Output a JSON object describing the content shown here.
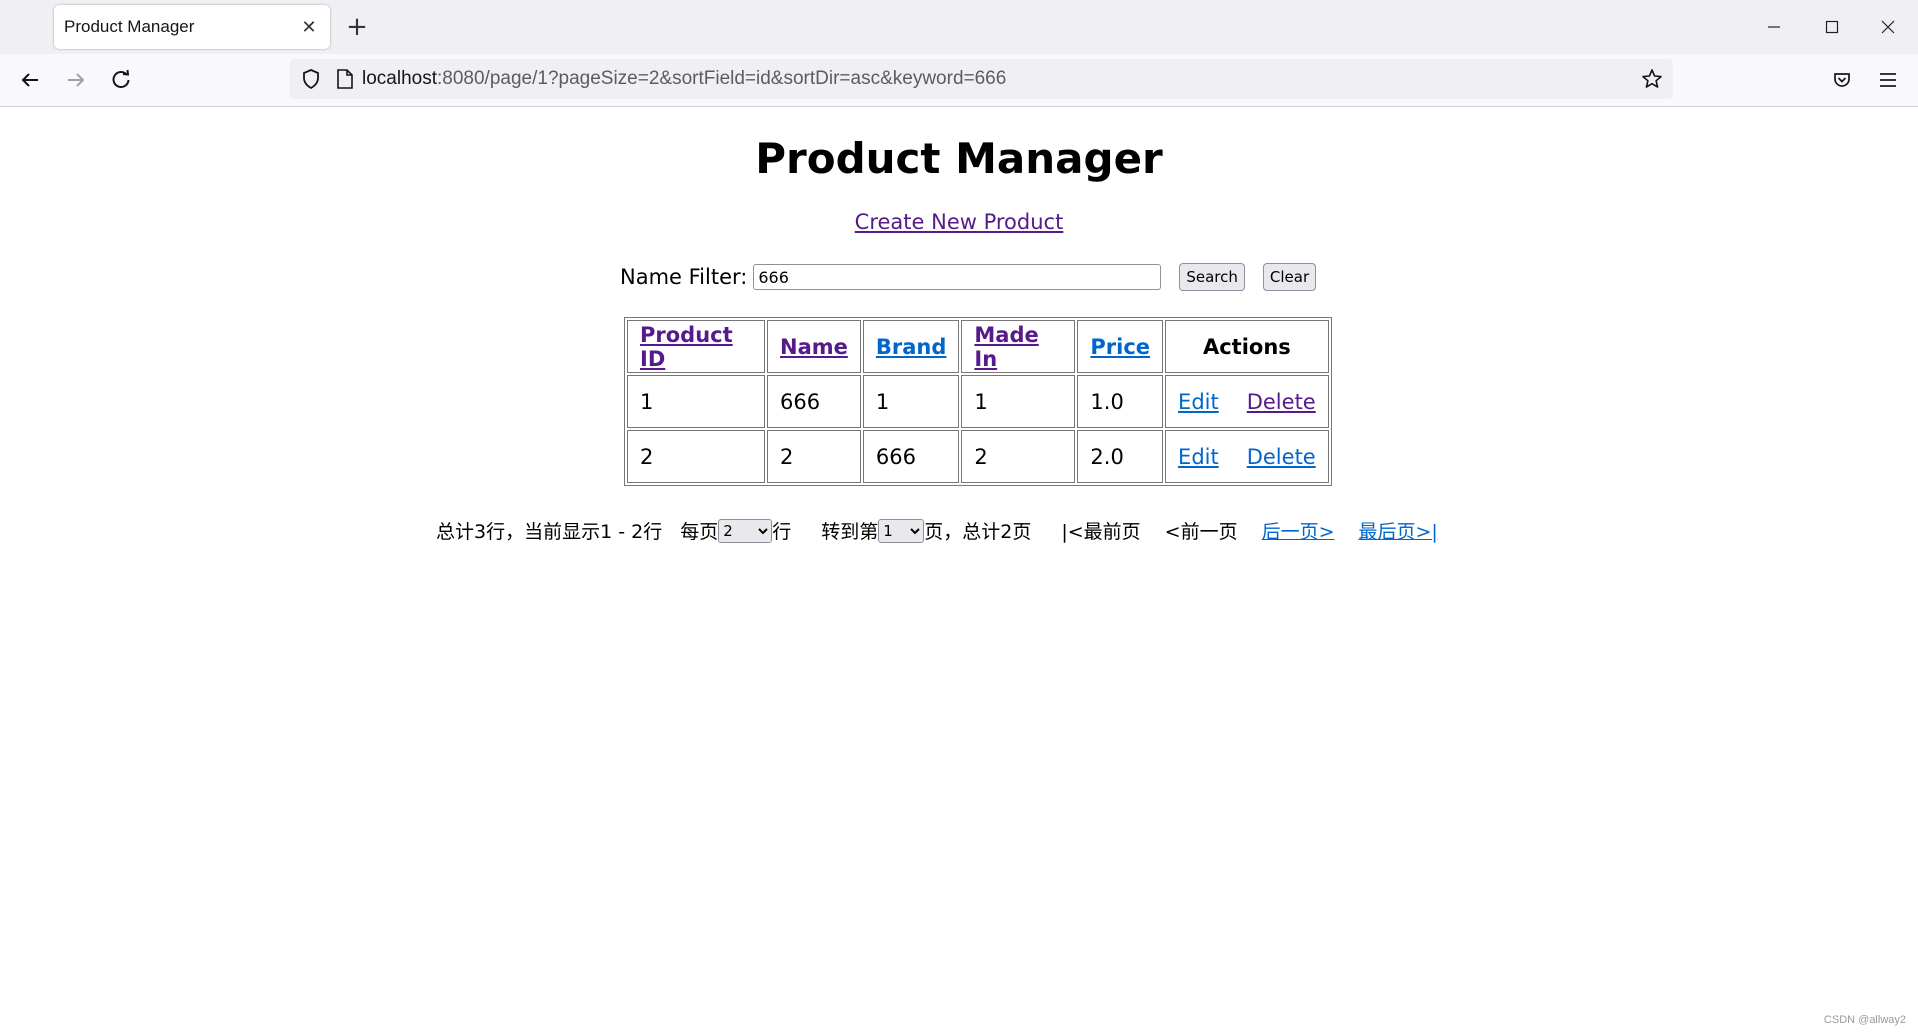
{
  "browser": {
    "tab_title": "Product Manager",
    "url_host": "localhost",
    "url_rest": ":8080/page/1?pageSize=2&sortField=id&sortDir=asc&keyword=666"
  },
  "page": {
    "title": "Product Manager",
    "create_link": "Create New Product",
    "filter_label": "Name Filter:",
    "filter_value": "666",
    "search_button": "Search",
    "clear_button": "Clear"
  },
  "table": {
    "headers": [
      "Product ID",
      "Name",
      "Brand",
      "Made In",
      "Price",
      "Actions"
    ],
    "rows": [
      {
        "id": "1",
        "name": "666",
        "brand": "1",
        "made_in": "1",
        "price": "1.0",
        "edit": "Edit",
        "delete": "Delete"
      },
      {
        "id": "2",
        "name": "2",
        "brand": "666",
        "made_in": "2",
        "price": "2.0",
        "edit": "Edit",
        "delete": "Delete"
      }
    ]
  },
  "pager": {
    "summary": "总计3行，当前显示1 - 2行",
    "per_page_prefix": "每页",
    "per_page_value": "2",
    "per_page_suffix": "行",
    "goto_prefix": "转到第",
    "goto_value": "1",
    "goto_suffix": "页，总计2页",
    "first": "|<最前页",
    "prev": "<前一页",
    "next": "后一页>",
    "last": "最后页>|"
  },
  "watermark": "CSDN @allway2",
  "colors": {
    "visited_link": "#551a8b",
    "link": "#0066cc"
  }
}
